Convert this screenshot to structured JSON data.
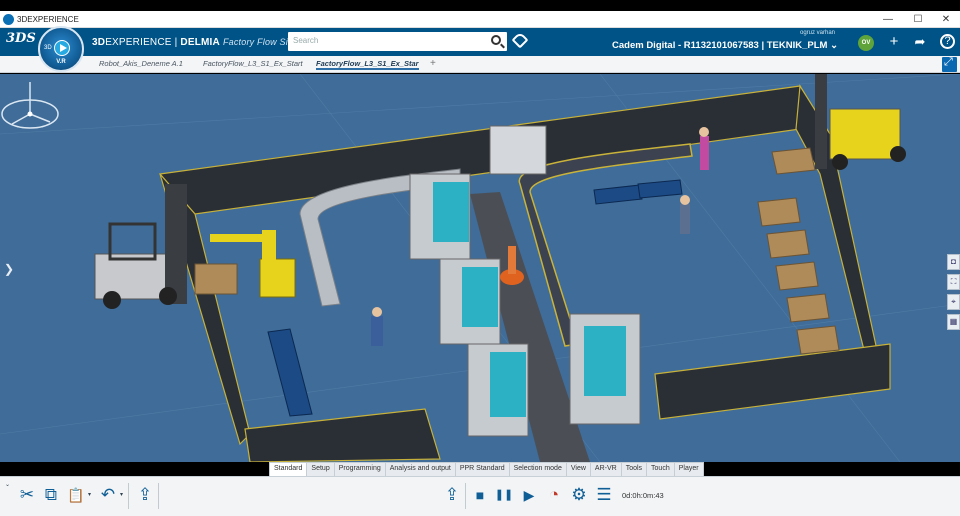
{
  "os": {
    "title": "3DEXPERIENCE",
    "minimize": "—",
    "maximize": "☐",
    "close": "✕"
  },
  "header": {
    "ds_logo": "3DS",
    "compass_3d": "3D",
    "compass_version": "V.R",
    "brand_prefix": "3D",
    "brand_main": "EXPERIENCE",
    "brand_sep": " | ",
    "brand_app": "DELMIA",
    "app_name": "Factory Flow Sim...",
    "search_placeholder": "Search",
    "tenant": "Cadem Digital - R1132101067583 | TEKNIK_PLM ⌄",
    "user_name": "ogruz varhan",
    "avatar_initials": "OV",
    "add_icon": "+",
    "share_icon": "➦",
    "help_icon": "?"
  },
  "tabs": [
    {
      "label": "Robot_Akis_Deneme A.1",
      "active": false
    },
    {
      "label": "FactoryFlow_L3_S1_Ex_Start",
      "active": false
    },
    {
      "label": "FactoryFlow_L3_S1_Ex_Star",
      "active": true
    }
  ],
  "tab_add": "+",
  "viewport": {
    "left_arrow": "❯",
    "floor_color": "#3f6c98",
    "right_tools": [
      "camera-icon",
      "3d-view-icon",
      "axis-icon",
      "layout-icon"
    ]
  },
  "action_tabs": [
    {
      "label": "Standard",
      "active": true
    },
    {
      "label": "Setup",
      "active": false
    },
    {
      "label": "Programming",
      "active": false
    },
    {
      "label": "Analysis and output",
      "active": false
    },
    {
      "label": "PPR Standard",
      "active": false
    },
    {
      "label": "Selection mode",
      "active": false
    },
    {
      "label": "View",
      "active": false
    },
    {
      "label": "AR-VR",
      "active": false
    },
    {
      "label": "Tools",
      "active": false
    },
    {
      "label": "Touch",
      "active": false
    },
    {
      "label": "Player",
      "active": false
    }
  ],
  "toolbar": {
    "cut_icon": "✂",
    "copy_icon": "⧉",
    "paste_icon": "📋",
    "undo_icon": "↶",
    "export_icon": "⇪",
    "stop_icon": "■",
    "pause_icon": "❚❚",
    "play_icon": "▶",
    "speed_icon": "◔",
    "settings_icon": "⚙",
    "list_icon": "☰",
    "timer": "0d:0h:0m:43"
  }
}
